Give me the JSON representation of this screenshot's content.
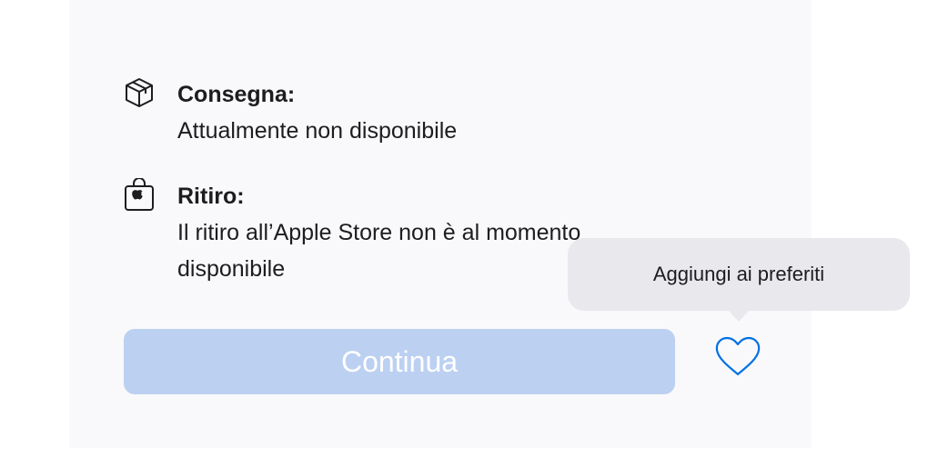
{
  "delivery": {
    "icon": "box-icon",
    "title": "Consegna:",
    "status": "Attualmente non disponibile"
  },
  "pickup": {
    "icon": "shopping-bag-apple-icon",
    "title": "Ritiro:",
    "status": "Il ritiro all’Apple Store non è al momento disponibile"
  },
  "actions": {
    "continue_label": "Continua",
    "continue_disabled": true,
    "favorite_icon": "heart-icon",
    "favorite_tooltip": "Aggiungi ai preferiti"
  },
  "colors": {
    "panel_background": "#f9f9fb",
    "button_disabled": "#bcd0f1",
    "accent_blue": "#0071e3",
    "tooltip_background": "#e8e8ed"
  }
}
